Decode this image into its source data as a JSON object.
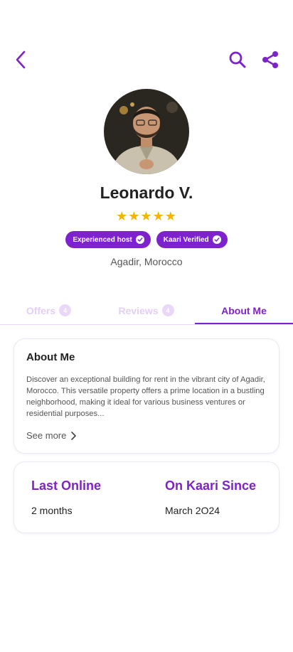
{
  "profile": {
    "name": "Leonardo V.",
    "rating": "★★★★★",
    "location": "Agadir, Morocco",
    "badges": [
      "Experienced host",
      "Kaari Verified"
    ]
  },
  "tabs": [
    {
      "label": "Offers",
      "count": "4"
    },
    {
      "label": "Reviews",
      "count": "4"
    },
    {
      "label": "About Me"
    }
  ],
  "about": {
    "title": "About Me",
    "text": "Discover an exceptional building for rent in the vibrant city of Agadir, Morocco. This versatile property offers a prime location in a bustling neighborhood, making it ideal for various business ventures or residential purposes...",
    "see_more": "See more"
  },
  "stats": {
    "last_online_label": "Last Online",
    "last_online_value": "2 months",
    "since_label": "On Kaari Since",
    "since_value": "March 2O24"
  },
  "colors": {
    "accent": "#7e22ce",
    "star": "#f4b400"
  },
  "icons": {
    "back": "chevron-left-icon",
    "search": "search-icon",
    "share": "share-icon"
  }
}
